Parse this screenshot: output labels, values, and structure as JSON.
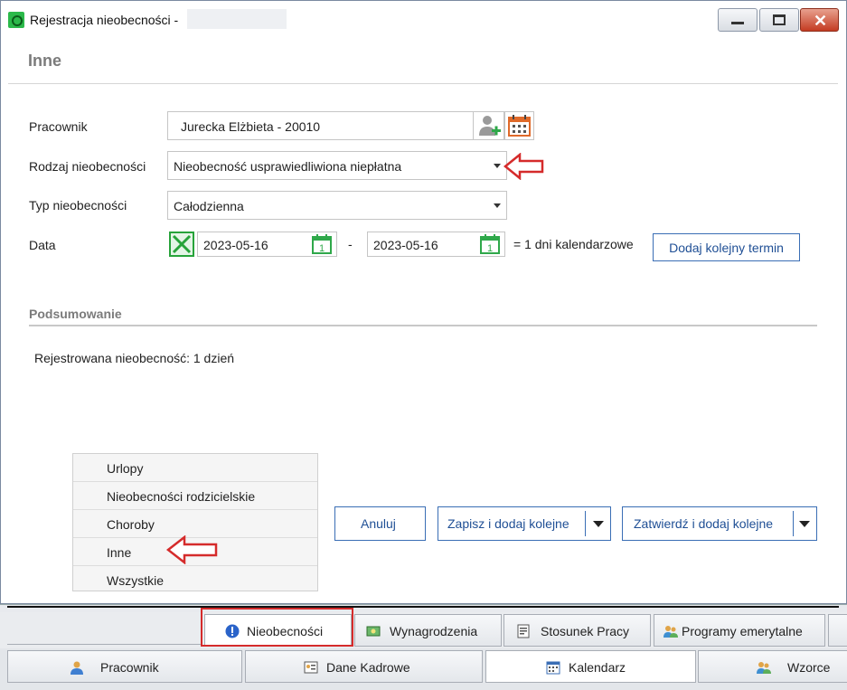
{
  "window": {
    "title": "Rejestracja nieobecności -",
    "heading": "Inne"
  },
  "form": {
    "pracownik_label": "Pracownik",
    "pracownik_value": "Jurecka Elżbieta - 20010",
    "rodzaj_label": "Rodzaj nieobecności",
    "rodzaj_value": "Nieobecność usprawiedliwiona niepłatna",
    "typ_label": "Typ nieobecności",
    "typ_value": "Całodzienna",
    "data_label": "Data",
    "date_from": "2023-05-16",
    "date_dash": "-",
    "date_to": "2023-05-16",
    "calendar_day": "1",
    "days_text": "= 1 dni kalendarzowe",
    "add_term_label": "Dodaj kolejny termin"
  },
  "summary": {
    "title": "Podsumowanie",
    "text": "Rejestrowana nieobecność: 1 dzień"
  },
  "side_menu": {
    "items": [
      {
        "label": "Urlopy"
      },
      {
        "label": "Nieobecności rodzicielskie"
      },
      {
        "label": "Choroby"
      },
      {
        "label": "Inne"
      },
      {
        "label": "Wszystkie"
      }
    ]
  },
  "actions": {
    "cancel_label": "Anuluj",
    "save_add_label": "Zapisz i dodaj kolejne",
    "confirm_add_label": "Zatwierdź i dodaj kolejne"
  },
  "tabs_row1": [
    {
      "label": "Nieobecności",
      "icon": "info-icon"
    },
    {
      "label": "Wynagrodzenia",
      "icon": "money-icon"
    },
    {
      "label": "Stosunek Pracy",
      "icon": "document-icon"
    },
    {
      "label": "Programy emerytalne",
      "icon": "people-icon"
    }
  ],
  "tabs_row2": [
    {
      "label": "Pracownik",
      "icon": "person-icon"
    },
    {
      "label": "Dane Kadrowe",
      "icon": "id-card-icon"
    },
    {
      "label": "Kalendarz",
      "icon": "calendar-icon"
    },
    {
      "label": "Wzorce",
      "icon": "people-icon"
    }
  ],
  "colors": {
    "accent": "#1f4f95",
    "annotation_red": "#d52b2b",
    "green": "#27a33a"
  }
}
